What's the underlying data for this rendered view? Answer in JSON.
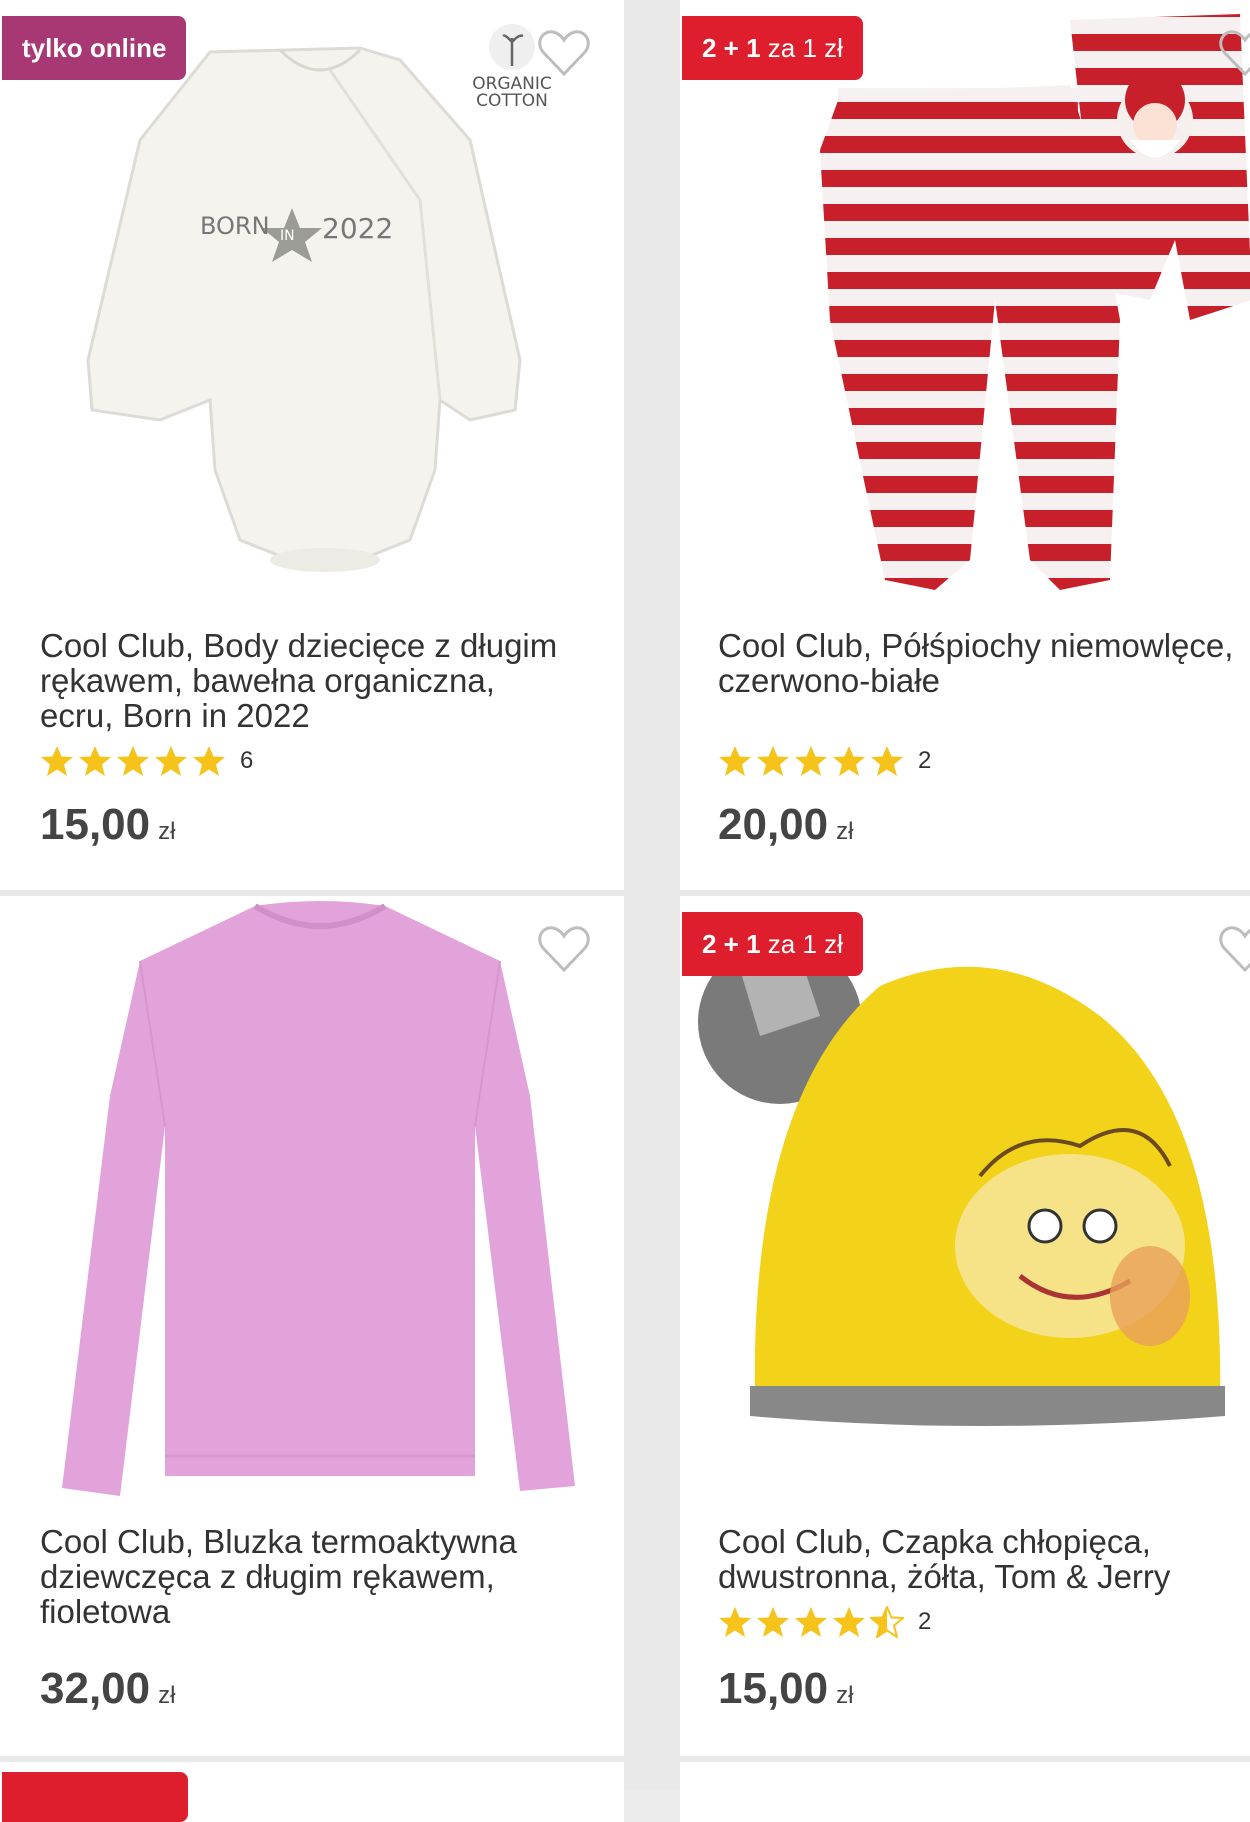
{
  "products": [
    {
      "badge": "tylko online",
      "organic_line1": "ORGANIC",
      "organic_line2": "COTTON",
      "print_text_left": "BORN",
      "print_text_mid": "IN",
      "print_text_right": "2022",
      "title_lines": [
        "Cool Club, Body dziecięce z długim",
        "rękawem, bawełna organiczna,",
        "ecru, Born in 2022"
      ],
      "rating": 5,
      "rating_count": "6",
      "price": "15,00",
      "currency": "zł",
      "icon": "heart-icon"
    },
    {
      "badge_num": "2 + 1",
      "badge_rest": " za 1 zł",
      "title_lines": [
        "Cool Club, Półśpiochy niemowlęce,",
        "czerwono-białe"
      ],
      "rating": 5,
      "rating_count": "2",
      "price": "20,00",
      "currency": "zł",
      "icon": "heart-icon"
    },
    {
      "title_lines": [
        "Cool Club, Bluzka termoaktywna",
        "dziewczęca z długim rękawem,",
        "fioletowa"
      ],
      "price": "32,00",
      "currency": "zł",
      "icon": "heart-icon"
    },
    {
      "badge_num": "2 + 1",
      "badge_rest": " za 1 zł",
      "title_lines": [
        "Cool Club, Czapka chłopięca,",
        "dwustronna, żółta, Tom & Jerry"
      ],
      "rating": 4.5,
      "rating_count": "2",
      "price": "15,00",
      "currency": "zł",
      "icon": "heart-icon"
    }
  ],
  "colors": {
    "online_badge": "#a73873",
    "promo_badge": "#de1e2d",
    "star": "#f6c31b"
  }
}
